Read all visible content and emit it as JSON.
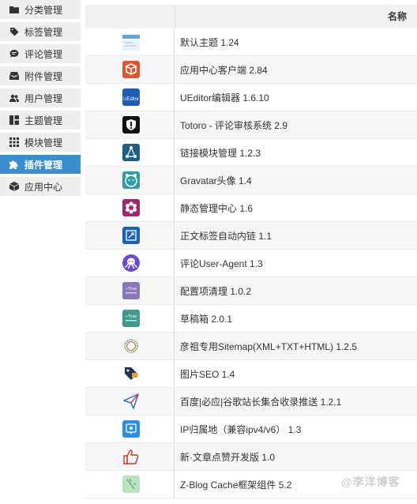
{
  "sidebar": {
    "items": [
      {
        "label": "分类管理",
        "icon": "folder-icon"
      },
      {
        "label": "标签管理",
        "icon": "tag-icon"
      },
      {
        "label": "评论管理",
        "icon": "comment-icon"
      },
      {
        "label": "附件管理",
        "icon": "inbox-icon"
      },
      {
        "label": "用户管理",
        "icon": "users-icon"
      },
      {
        "label": "主题管理",
        "icon": "layout-icon"
      },
      {
        "label": "模块管理",
        "icon": "grid-icon"
      },
      {
        "label": "插件管理",
        "icon": "puzzle-icon"
      },
      {
        "label": "应用中心",
        "icon": "box-icon"
      }
    ],
    "active_index": 7
  },
  "table": {
    "header_name": "名称",
    "rows": [
      {
        "name": "默认主题 1.24",
        "icon": "default-theme-icon"
      },
      {
        "name": "应用中心客户端 2.84",
        "icon": "app-center-icon"
      },
      {
        "name": "UEditor编辑器 1.6.10",
        "icon": "ueditor-icon"
      },
      {
        "name": "Totoro - 评论审核系统 2.9",
        "icon": "totoro-shield-icon"
      },
      {
        "name": "链接模块管理 1.2.3",
        "icon": "link-share-icon"
      },
      {
        "name": "Gravatar头像 1.4",
        "icon": "gravatar-icon"
      },
      {
        "name": "静态管理中心 1.6",
        "icon": "static-flower-icon"
      },
      {
        "name": "正文标签自动内链 1.1",
        "icon": "auto-link-icon"
      },
      {
        "name": "评论User-Agent 1.3",
        "icon": "octopus-icon"
      },
      {
        "name": "配置项清理 1.0.2",
        "icon": "config-clean-icon"
      },
      {
        "name": "草稿箱 2.0.1",
        "icon": "draft-box-icon"
      },
      {
        "name": "彦祖专用Sitemap(XML+TXT+HTML) 1.2.5",
        "icon": "sitemap-icon"
      },
      {
        "name": "图片SEO 1.4",
        "icon": "image-seo-tag-icon"
      },
      {
        "name": "百度|必应|谷歌站长集合收录推送 1.2.1",
        "icon": "push-arrow-icon"
      },
      {
        "name": "IP归属地（兼容ipv4/v6） 1.3",
        "icon": "ip-location-icon"
      },
      {
        "name": "新·文章点赞开发版 1.0",
        "icon": "thumbs-up-icon"
      },
      {
        "name": "Z-Blog Cache框架组件 5.2",
        "icon": "cache-icon"
      }
    ]
  },
  "small_icon_text": {
    "ueditor": "UEditor",
    "tinai": "+Tinai"
  },
  "watermark": "@李洋博客",
  "colors": {
    "active": "#3a90cf",
    "sidebar_bg": "#eeeeee"
  }
}
